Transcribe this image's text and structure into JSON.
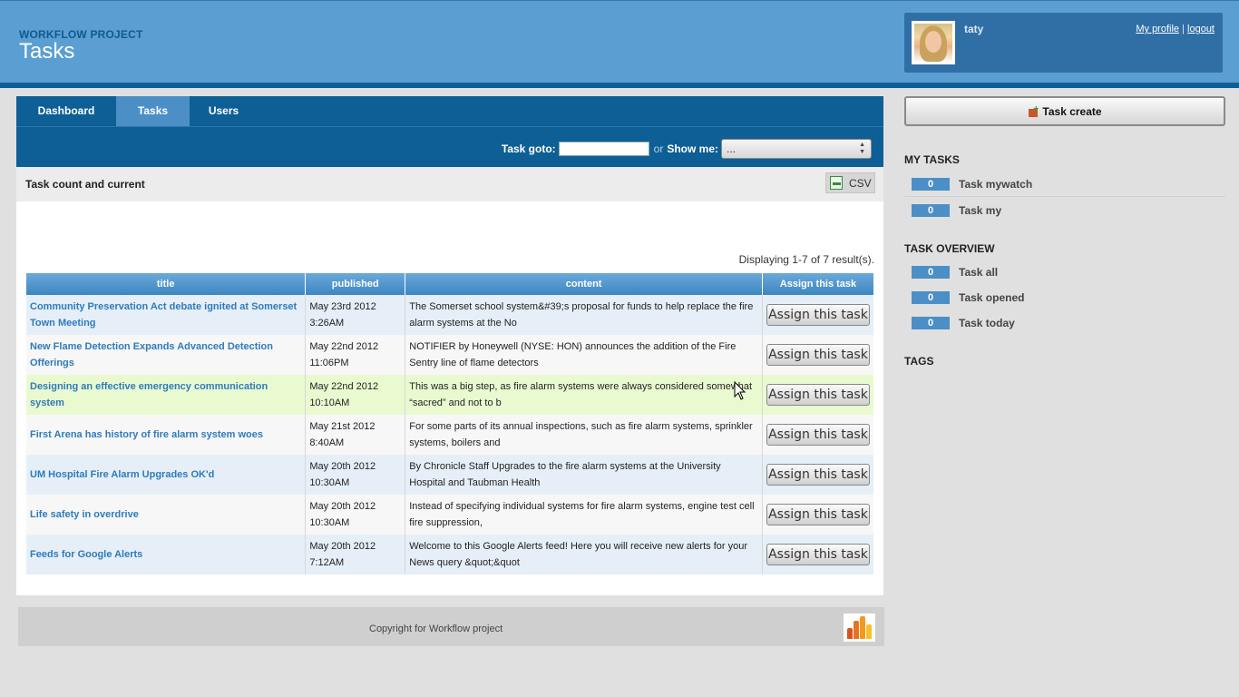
{
  "header": {
    "project_label": "WORKFLOW PROJECT",
    "title": "Tasks",
    "user": {
      "name": "taty",
      "profile_link": "My profile",
      "separator": "|",
      "logout_link": "logout"
    }
  },
  "tabs": [
    {
      "label": "Dashboard",
      "active": false
    },
    {
      "label": "Tasks",
      "active": true
    },
    {
      "label": "Users",
      "active": false
    }
  ],
  "toolbar": {
    "goto_label": "Task goto:",
    "goto_value": "",
    "or_label": "or",
    "showme_label": "Show me:",
    "showme_selected": "..."
  },
  "panel": {
    "title": "Task count and current",
    "csv_label": "CSV",
    "summary": "Displaying 1-7 of 7 result(s)."
  },
  "table": {
    "columns": [
      "title",
      "published",
      "content",
      "Assign this task"
    ],
    "rows": [
      {
        "title": "Community Preservation Act debate ignited at Somerset Town Meeting",
        "published": "May 23rd 2012 3:26AM",
        "content": "The Somerset school system&#39;s proposal for funds to help replace the fire alarm systems at the No",
        "action": "Assign this task"
      },
      {
        "title": "New Flame Detection Expands Advanced Detection Offerings",
        "published": "May 22nd 2012 11:06PM",
        "content": "NOTIFIER by Honeywell (NYSE: HON) announces the addition of the Fire Sentry line of flame detectors",
        "action": "Assign this task"
      },
      {
        "title": "Designing an effective emergency communication system",
        "published": "May 22nd 2012 10:10AM",
        "content": "This was a big step, as fire alarm systems were always considered somewhat “sacred” and not to b",
        "action": "Assign this task"
      },
      {
        "title": "First Arena has history of fire alarm system woes",
        "published": "May 21st 2012 8:40AM",
        "content": "For some parts of its annual inspections, such as fire alarm systems, sprinkler systems, boilers and",
        "action": "Assign this task"
      },
      {
        "title": "UM Hospital Fire Alarm Upgrades OK'd",
        "published": "May 20th 2012 10:30AM",
        "content": "By Chronicle Staff Upgrades to the fire alarm systems at the University Hospital and Taubman Health",
        "action": "Assign this task"
      },
      {
        "title": "Life safety in overdrive",
        "published": "May 20th 2012 10:30AM",
        "content": "Instead of specifying individual systems for fire alarm systems, engine test cell fire suppression,",
        "action": "Assign this task"
      },
      {
        "title": "Feeds for Google Alerts",
        "published": "May 20th 2012 7:12AM",
        "content": "Welcome to this Google Alerts feed! Here you will receive new alerts for your News query &quot;&quot",
        "action": "Assign this task"
      }
    ]
  },
  "footer": {
    "copyright": "Copyright for Workflow project"
  },
  "sidebar": {
    "task_create_label": "Task create",
    "my_tasks": {
      "title": "MY TASKS",
      "items": [
        {
          "count": "0",
          "label": "Task mywatch"
        },
        {
          "count": "0",
          "label": "Task my"
        }
      ]
    },
    "task_overview": {
      "title": "TASK OVERVIEW",
      "items": [
        {
          "count": "0",
          "label": "Task all"
        },
        {
          "count": "0",
          "label": "Task opened"
        },
        {
          "count": "0",
          "label": "Task today"
        }
      ]
    },
    "tags": {
      "title": "TAGS"
    }
  },
  "colors": {
    "header_bg": "#5b9fd2",
    "nav_bg": "#0e5f95",
    "active_tab": "#4b8fc6",
    "link": "#2d7bbd",
    "row_hover": "#eafad0"
  }
}
